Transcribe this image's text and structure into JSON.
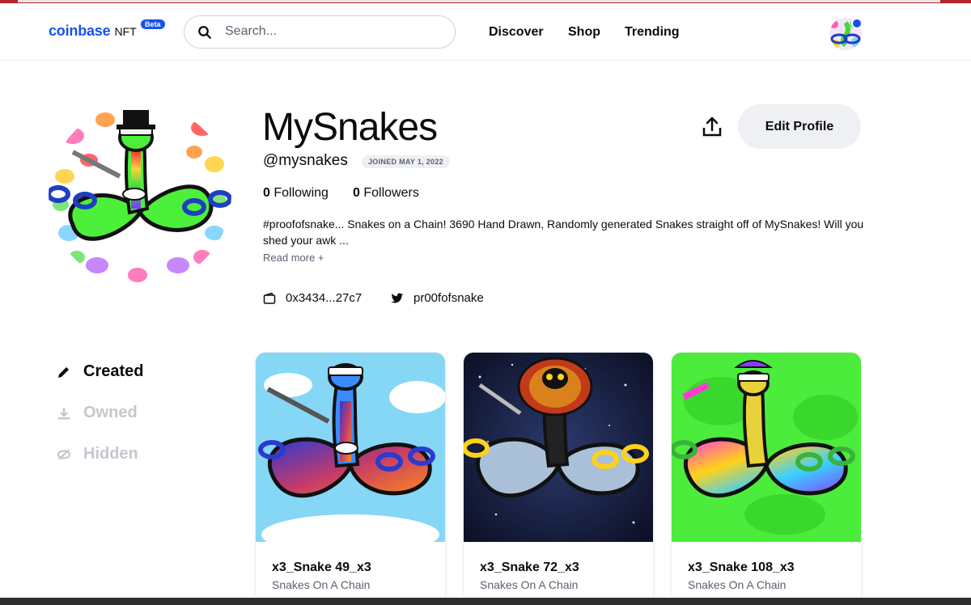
{
  "header": {
    "logo": "coinbase",
    "logo_suffix": "NFT",
    "beta_badge": "Beta",
    "search_placeholder": "Search...",
    "nav": [
      "Discover",
      "Shop",
      "Trending"
    ]
  },
  "profile": {
    "name": "MySnakes",
    "handle": "@mysnakes",
    "joined": "JOINED MAY 1, 2022",
    "following_count": "0",
    "following_label": "Following",
    "followers_count": "0",
    "followers_label": "Followers",
    "bio": "#proofofsnake... Snakes on a Chain! 3690 Hand Drawn, Randomly generated Snakes straight off of MySnakes! Will you shed your awk ...",
    "read_more": "Read more +",
    "wallet": "0x3434...27c7",
    "twitter": "pr00fofsnake",
    "edit_button": "Edit Profile"
  },
  "tabs": [
    {
      "label": "Created",
      "active": true,
      "icon": "pencil-icon"
    },
    {
      "label": "Owned",
      "active": false,
      "icon": "download-icon"
    },
    {
      "label": "Hidden",
      "active": false,
      "icon": "eye-slash-icon"
    }
  ],
  "cards": [
    {
      "title": "x3_Snake 49_x3",
      "collection": "Snakes On A Chain"
    },
    {
      "title": "x3_Snake 72_x3",
      "collection": "Snakes On A Chain"
    },
    {
      "title": "x3_Snake 108_x3",
      "collection": "Snakes On A Chain"
    }
  ],
  "colors": {
    "brand": "#1652f0",
    "text": "#0a0b0d",
    "muted": "#5b616e",
    "inactive_tab": "#c4c8ce",
    "button_bg": "#eef0f3"
  }
}
